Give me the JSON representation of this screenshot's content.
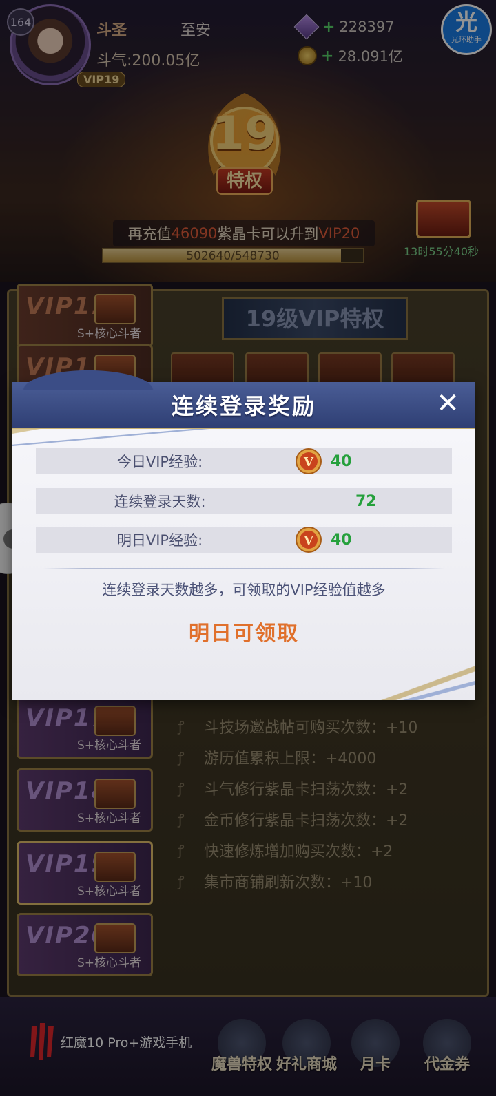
{
  "header": {
    "player_level": "164",
    "rank_title": "斗圣",
    "player_name": "至安",
    "dou_qi_text": "斗气:200.05亿",
    "vip_tag": "VIP19",
    "gems": "228397",
    "coins": "28.091亿",
    "helper_glyph": "光",
    "helper_label": "光环助手"
  },
  "vip_status": {
    "current_level": "19",
    "emblem_label": "特权",
    "upgrade_prefix": "再充值",
    "upgrade_amount": "46090",
    "upgrade_mid": "紫晶卡可以升到",
    "upgrade_target": "VIP20",
    "progress_text": "502640/548730",
    "progress_fraction": 0.916,
    "countdown": "13时55分40秒"
  },
  "panel": {
    "privilege_title": "19级VIP特权",
    "vip_cards": [
      {
        "label": "VIP11",
        "sub": "S+核心斗者",
        "style": "brown"
      },
      {
        "label": "VIP12",
        "sub": "",
        "style": "brown"
      },
      {
        "label": "VIP17",
        "sub": "S+核心斗者",
        "style": "purple"
      },
      {
        "label": "VIP18",
        "sub": "S+核心斗者",
        "style": "purple"
      },
      {
        "label": "VIP19",
        "sub": "S+核心斗者",
        "style": "purple"
      },
      {
        "label": "VIP20",
        "sub": "S+核心斗者",
        "style": "purple"
      }
    ],
    "benefits": [
      "斗技场邀战帖可购买次数：+10",
      "游历值累积上限：+4000",
      "斗气修行紫晶卡扫荡次数：+2",
      "金币修行紫晶卡扫荡次数：+2",
      "快速修炼增加购买次数：+2",
      "集市商铺刷新次数：+10"
    ]
  },
  "bottom_tabs": [
    {
      "label": "魔兽特权"
    },
    {
      "label": "好礼商城"
    },
    {
      "label": "月卡"
    },
    {
      "label": "代金券"
    }
  ],
  "brand": {
    "text": "红魔10 Pro+游戏手机"
  },
  "modal": {
    "title": "连续登录奖励",
    "close": "✕",
    "rows": [
      {
        "label": "今日VIP经验:",
        "value": "40",
        "has_icon": true
      },
      {
        "label": "连续登录天数:",
        "value": "72",
        "has_icon": false
      },
      {
        "label": "明日VIP经验:",
        "value": "40",
        "has_icon": true
      }
    ],
    "hint": "连续登录天数越多，可领取的VIP经验值越多",
    "claim_status": "明日可领取"
  },
  "colors": {
    "value_green": "#25a03c",
    "claim_orange": "#e0702c",
    "header_blue": "#3b4d86",
    "accent_red": "#e15c3a"
  },
  "icons": {
    "vip_exp": "vip-medal-icon",
    "close": "close-icon",
    "controller": "gamepad-icon"
  }
}
